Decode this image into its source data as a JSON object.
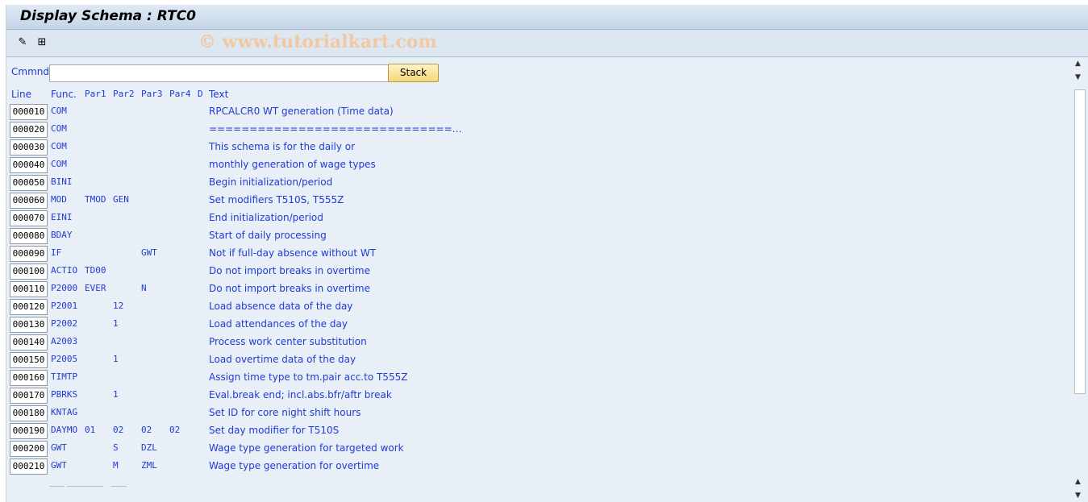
{
  "title": "Display Schema : RTC0",
  "watermark": "© www.tutorialkart.com",
  "toolbar": {
    "icons": [
      "edit-pencil-icon",
      "hierarchy-icon"
    ]
  },
  "command": {
    "label": "Cmmnd",
    "value": "",
    "stack_label": "Stack"
  },
  "headers": {
    "line": "Line",
    "func": "Func.",
    "par1": "Par1",
    "par2": "Par2",
    "par3": "Par3",
    "par4": "Par4",
    "d": "D",
    "text": "Text"
  },
  "rows": [
    {
      "line": "000010",
      "func": "COM",
      "par1": "",
      "par2": "",
      "par3": "",
      "par4": "",
      "text": "RPCALCR0 WT generation (Time data)"
    },
    {
      "line": "000020",
      "func": "COM",
      "par1": "",
      "par2": "",
      "par3": "",
      "par4": "",
      "text": "==============================…"
    },
    {
      "line": "000030",
      "func": "COM",
      "par1": "",
      "par2": "",
      "par3": "",
      "par4": "",
      "text": "This schema is for the daily or"
    },
    {
      "line": "000040",
      "func": "COM",
      "par1": "",
      "par2": "",
      "par3": "",
      "par4": "",
      "text": "monthly generation of wage types"
    },
    {
      "line": "000050",
      "func": "BINI",
      "par1": "",
      "par2": "",
      "par3": "",
      "par4": "",
      "text": "Begin initialization/period"
    },
    {
      "line": "000060",
      "func": "MOD",
      "par1": "TMOD",
      "par2": "GEN",
      "par3": "",
      "par4": "",
      "text": "Set modifiers T510S, T555Z"
    },
    {
      "line": "000070",
      "func": "EINI",
      "par1": "",
      "par2": "",
      "par3": "",
      "par4": "",
      "text": "End initialization/period"
    },
    {
      "line": "000080",
      "func": "BDAY",
      "par1": "",
      "par2": "",
      "par3": "",
      "par4": "",
      "text": "Start of daily processing"
    },
    {
      "line": "000090",
      "func": "IF",
      "par1": "",
      "par2": "",
      "par3": "GWT",
      "par4": "",
      "text": "Not if full-day absence without WT"
    },
    {
      "line": "000100",
      "func": "ACTIO",
      "par1": "TD00",
      "par2": "",
      "par3": "",
      "par4": "",
      "text": "Do not import breaks in overtime"
    },
    {
      "line": "000110",
      "func": "P2000",
      "par1": "EVER",
      "par2": "",
      "par3": "N",
      "par4": "",
      "text": "Do not import breaks in overtime"
    },
    {
      "line": "000120",
      "func": "P2001",
      "par1": "",
      "par2": "12",
      "par3": "",
      "par4": "",
      "text": "Load absence data of the day"
    },
    {
      "line": "000130",
      "func": "P2002",
      "par1": "",
      "par2": "1",
      "par3": "",
      "par4": "",
      "text": "Load attendances of the day"
    },
    {
      "line": "000140",
      "func": "A2003",
      "par1": "",
      "par2": "",
      "par3": "",
      "par4": "",
      "text": "Process work center substitution"
    },
    {
      "line": "000150",
      "func": "P2005",
      "par1": "",
      "par2": "1",
      "par3": "",
      "par4": "",
      "text": "Load overtime data of the day"
    },
    {
      "line": "000160",
      "func": "TIMTP",
      "par1": "",
      "par2": "",
      "par3": "",
      "par4": "",
      "text": "Assign time type to tm.pair acc.to T555Z"
    },
    {
      "line": "000170",
      "func": "PBRKS",
      "par1": "",
      "par2": "1",
      "par3": "",
      "par4": "",
      "text": "Eval.break end; incl.abs.bfr/aftr break"
    },
    {
      "line": "000180",
      "func": "KNTAG",
      "par1": "",
      "par2": "",
      "par3": "",
      "par4": "",
      "text": "Set ID for core night shift hours"
    },
    {
      "line": "000190",
      "func": "DAYMO",
      "par1": "01",
      "par2": "02",
      "par3": "02",
      "par4": "02",
      "text": "Set day modifier for T510S"
    },
    {
      "line": "000200",
      "func": "GWT",
      "par1": "",
      "par2": "S",
      "par3": "DZL",
      "par4": "",
      "text": "Wage type generation for targeted work"
    },
    {
      "line": "000210",
      "func": "GWT",
      "par1": "",
      "par2": "M",
      "par3": "ZML",
      "par4": "",
      "text": "Wage type generation for overtime"
    }
  ]
}
